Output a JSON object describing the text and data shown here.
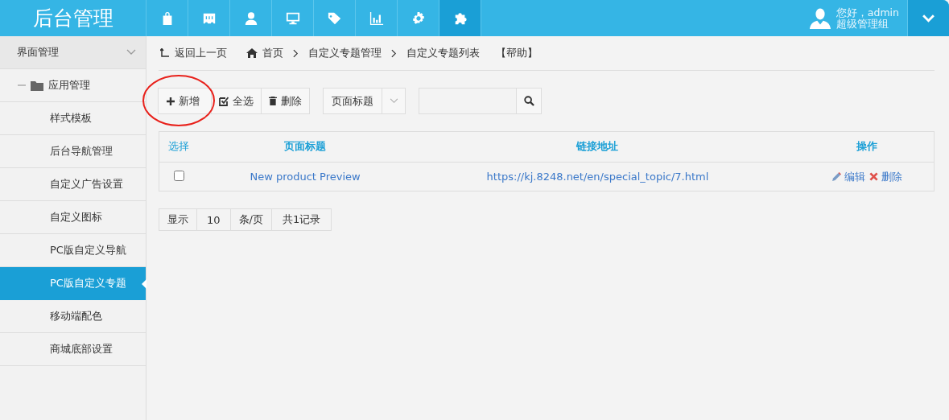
{
  "header": {
    "title": "后台管理",
    "nav_items": [
      {
        "kind": "bag",
        "selected": false
      },
      {
        "kind": "ticket",
        "selected": false
      },
      {
        "kind": "user",
        "selected": false
      },
      {
        "kind": "monitor",
        "selected": false
      },
      {
        "kind": "tag",
        "selected": false
      },
      {
        "kind": "chart",
        "selected": false
      },
      {
        "kind": "gear",
        "selected": false
      },
      {
        "kind": "puzzle",
        "selected": true
      }
    ],
    "user": {
      "greeting": "您好，admin",
      "role": "超级管理组"
    }
  },
  "sidebar": {
    "section": {
      "label": "界面管理",
      "expanded": true
    },
    "group": {
      "label": "应用管理",
      "expanded": true
    },
    "items": [
      {
        "label": "样式模板",
        "selected": false
      },
      {
        "label": "后台导航管理",
        "selected": false
      },
      {
        "label": "自定义广告设置",
        "selected": false
      },
      {
        "label": "自定义图标",
        "selected": false
      },
      {
        "label": "PC版自定义导航",
        "selected": false
      },
      {
        "label": "PC版自定义专题",
        "selected": true
      },
      {
        "label": "移动端配色",
        "selected": false
      },
      {
        "label": "商城底部设置",
        "selected": false
      }
    ]
  },
  "breadcrumb": {
    "back": "返回上一页",
    "links": [
      "首页",
      "自定义专题管理",
      "自定义专题列表"
    ],
    "help": "【帮助】"
  },
  "toolbar": {
    "buttons": [
      {
        "kind": "add",
        "label": "新增"
      },
      {
        "kind": "select_all",
        "label": "全选"
      },
      {
        "kind": "delete",
        "label": "删除"
      }
    ],
    "filter": {
      "value": "页面标题"
    }
  },
  "table": {
    "columns": [
      "选择",
      "页面标题",
      "链接地址",
      "操作"
    ],
    "rows": [
      {
        "checked": false,
        "title": "New product Preview",
        "url": "https://kj.8248.net/en/special_topic/7.html",
        "actions": [
          {
            "kind": "edit",
            "label": "编辑"
          },
          {
            "kind": "delete",
            "label": "删除"
          }
        ]
      }
    ]
  },
  "pagination": {
    "show": "显示",
    "page_size": "10",
    "unit": "条/页",
    "total": "共1记录"
  },
  "annotations": [
    {
      "kind": "circle"
    }
  ]
}
